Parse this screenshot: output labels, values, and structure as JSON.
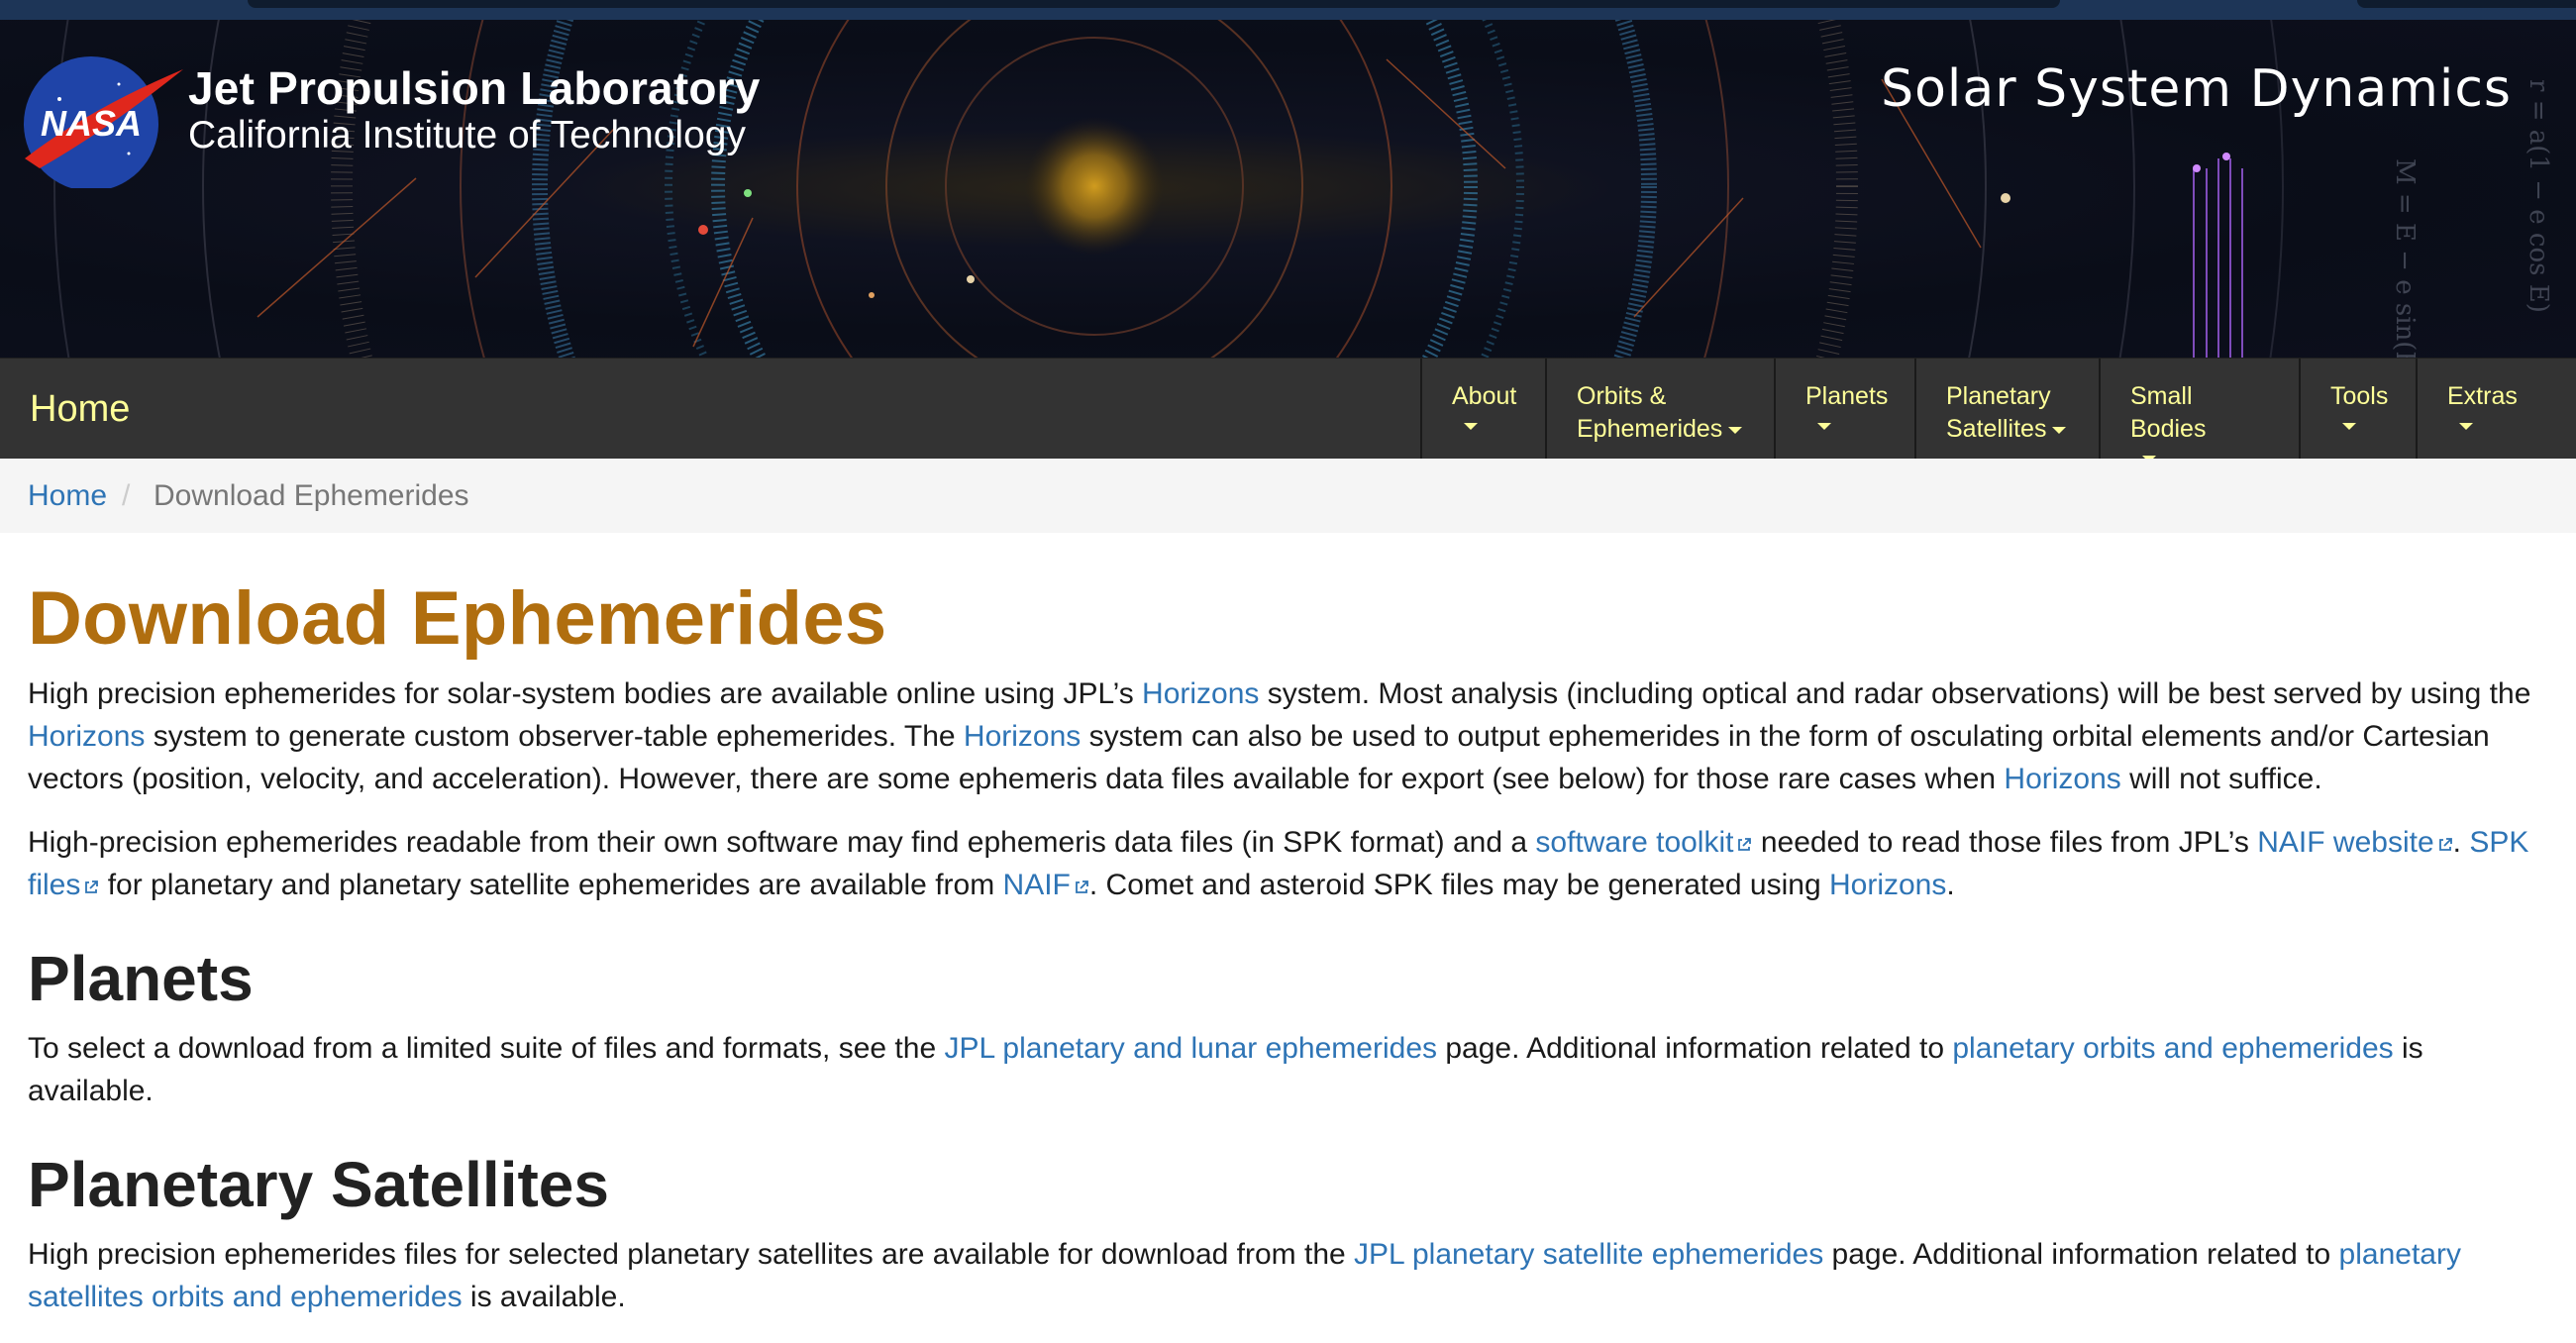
{
  "header": {
    "org_title": "Jet Propulsion Laboratory",
    "org_subtitle": "California Institute of Technology",
    "site_title": "Solar System Dynamics",
    "logo_text": "NASA"
  },
  "nav": {
    "home": "Home",
    "items": [
      {
        "line1": "About",
        "line2": ""
      },
      {
        "line1": "Orbits &",
        "line2": "Ephemerides"
      },
      {
        "line1": "Planets",
        "line2": ""
      },
      {
        "line1": "Planetary",
        "line2": "Satellites"
      },
      {
        "line1": "Small Bodies",
        "line2": ""
      },
      {
        "line1": "Tools",
        "line2": ""
      },
      {
        "line1": "Extras",
        "line2": ""
      }
    ]
  },
  "breadcrumb": {
    "home": "Home",
    "separator": "/",
    "current": "Download Ephemerides"
  },
  "main": {
    "title": "Download Ephemerides",
    "intro": {
      "t1": "High precision ephemerides for solar-system bodies are available online using JPL’s ",
      "l1": "Horizons",
      "t2": " system. Most analysis (including optical and radar observations) will be best served by using the ",
      "l2": "Horizons",
      "t3": " system to generate custom observer-table ephemerides. The ",
      "l3": "Horizons",
      "t4": " system can also be used to output ephemerides in the form of osculating orbital elements and/or Cartesian vectors (position, velocity, and acceleration). However, there are some ephemeris data files available for export (see below) for those rare cases when ",
      "l4": "Horizons",
      "t5": " will not suffice."
    },
    "spk": {
      "t1": "High-precision ephemerides readable from their own software may find ephemeris data files (in SPK format) and a ",
      "l1": "software toolkit",
      "t2": " needed to read those files from JPL’s ",
      "l2": "NAIF website",
      "t3": ". ",
      "l3": "SPK files",
      "t4": " for planetary and planetary satellite ephemerides are available from ",
      "l4": "NAIF",
      "t5": ". Comet and asteroid SPK files may be generated using ",
      "l5": "Horizons",
      "t6": "."
    },
    "planets": {
      "heading": "Planets",
      "t1": "To select a download from a limited suite of files and formats, see the ",
      "l1": "JPL planetary and lunar ephemerides",
      "t2": " page. Additional information related to ",
      "l2": "planetary orbits and ephemerides",
      "t3": " is available."
    },
    "satellites": {
      "heading": "Planetary Satellites",
      "t1": "High precision ephemerides files for selected planetary satellites are available for download from the ",
      "l1": "JPL planetary satellite ephemerides",
      "t2": " page. Additional information related to ",
      "l2": "planetary satellites orbits and ephemerides",
      "t3": " is available."
    }
  },
  "colors": {
    "title_orange": "#b06e0f",
    "link_blue": "#2e74b5",
    "nav_bg": "#333333",
    "nav_text": "#ffff99"
  }
}
